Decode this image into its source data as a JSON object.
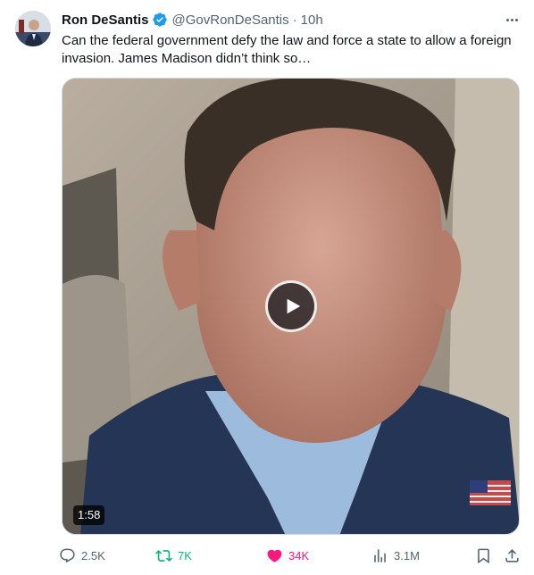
{
  "tweet": {
    "author_name": "Ron DeSantis",
    "handle": "@GovRonDeSantis",
    "separator": "·",
    "time": "10h",
    "text": "Can the federal government defy the law and force a state to allow a foreign invasion.  James Madison didn’t think so…",
    "video_duration": "1:58",
    "verified_color": "#1d9bf0"
  },
  "actions": {
    "replies": "2.5K",
    "retweets": "7K",
    "likes": "34K",
    "views": "3.1M",
    "reply_icon": "reply-icon",
    "retweet_icon": "retweet-icon",
    "like_icon": "heart-icon",
    "views_icon": "views-icon",
    "bookmark_icon": "bookmark-icon",
    "share_icon": "share-icon",
    "retweeted_color": "#00ba7c",
    "liked_color": "#f91880"
  }
}
